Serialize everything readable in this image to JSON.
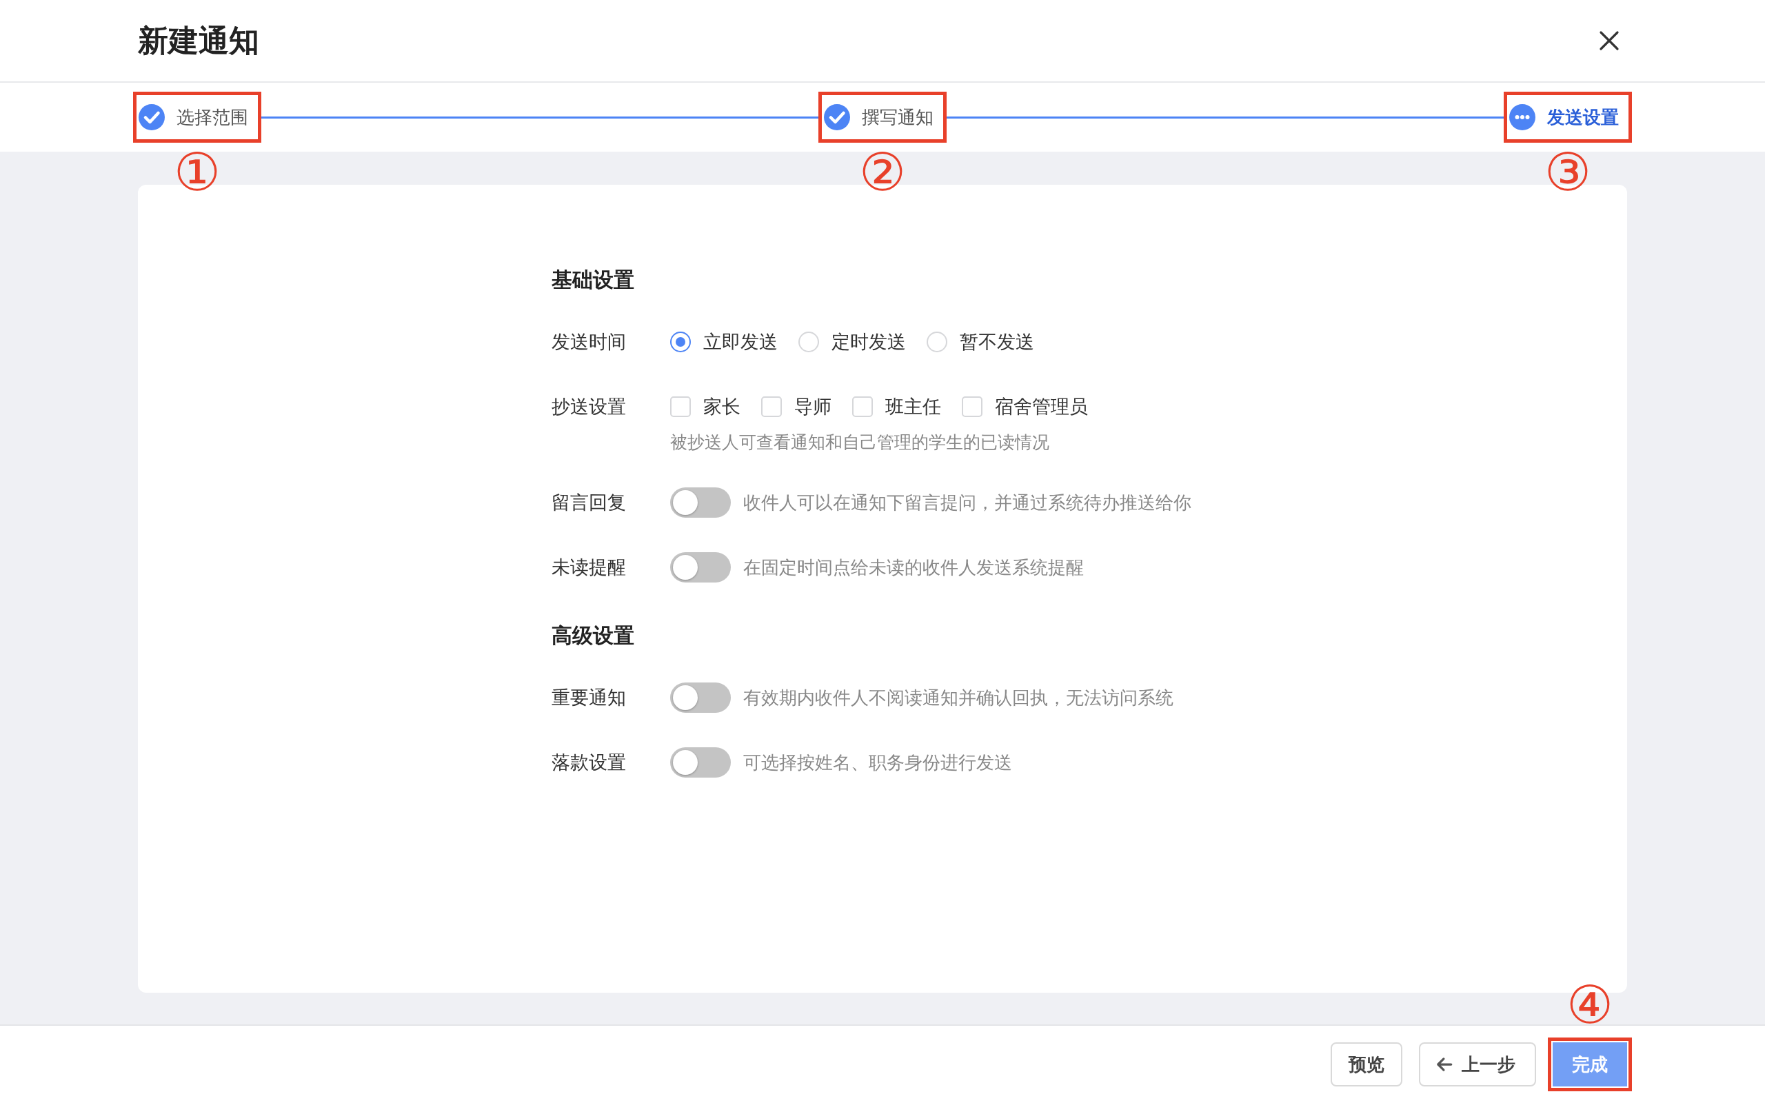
{
  "dialog": {
    "title": "新建通知"
  },
  "steps": [
    {
      "label": "选择范围",
      "done": true,
      "callout": "①"
    },
    {
      "label": "撰写通知",
      "done": true,
      "callout": "②"
    },
    {
      "label": "发送设置",
      "done": false,
      "callout": "③"
    }
  ],
  "sections": [
    {
      "title": "基础设置",
      "rows": [
        {
          "kind": "radio",
          "label": "发送时间",
          "options": [
            {
              "label": "立即发送",
              "selected": true
            },
            {
              "label": "定时发送",
              "selected": false
            },
            {
              "label": "暂不发送",
              "selected": false
            }
          ]
        },
        {
          "kind": "checkbox",
          "label": "抄送设置",
          "options": [
            {
              "label": "家长",
              "checked": false
            },
            {
              "label": "导师",
              "checked": false
            },
            {
              "label": "班主任",
              "checked": false
            },
            {
              "label": "宿舍管理员",
              "checked": false
            }
          ],
          "hint": "被抄送人可查看通知和自己管理的学生的已读情况"
        },
        {
          "kind": "switch",
          "label": "留言回复",
          "on": false,
          "description": "收件人可以在通知下留言提问，并通过系统待办推送给你"
        },
        {
          "kind": "switch",
          "label": "未读提醒",
          "on": false,
          "description": "在固定时间点给未读的收件人发送系统提醒"
        }
      ]
    },
    {
      "title": "高级设置",
      "rows": [
        {
          "kind": "switch",
          "label": "重要通知",
          "on": false,
          "description": "有效期内收件人不阅读通知并确认回执，无法访问系统"
        },
        {
          "kind": "switch",
          "label": "落款设置",
          "on": false,
          "description": "可选择按姓名、职务身份进行发送"
        }
      ]
    }
  ],
  "footer_buttons": [
    {
      "label": "预览",
      "kind": "default"
    },
    {
      "label": "上一步",
      "kind": "back"
    },
    {
      "label": "完成",
      "kind": "primary",
      "callout": "④"
    }
  ]
}
